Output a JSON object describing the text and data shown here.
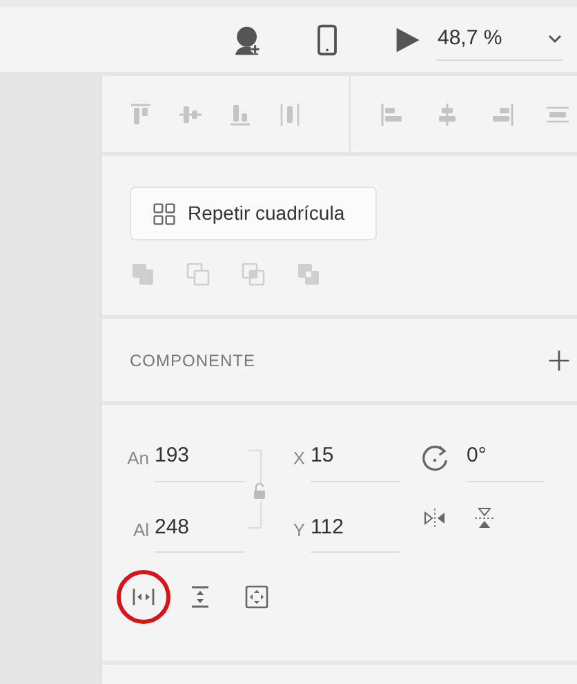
{
  "toolbar": {
    "zoom": "48,7 %"
  },
  "alignment": {
    "disabled": true
  },
  "grid_button": {
    "label": "Repetir cuadrícula"
  },
  "boolean_ops": {
    "disabled": true
  },
  "component": {
    "title": "COMPONENTE"
  },
  "transform": {
    "fields": [
      {
        "label": "An",
        "value": "193"
      },
      {
        "label": "X",
        "value": "15"
      },
      {
        "label": "Al",
        "value": "248"
      },
      {
        "label": "Y",
        "value": "112"
      }
    ],
    "rotation": "0°"
  }
}
